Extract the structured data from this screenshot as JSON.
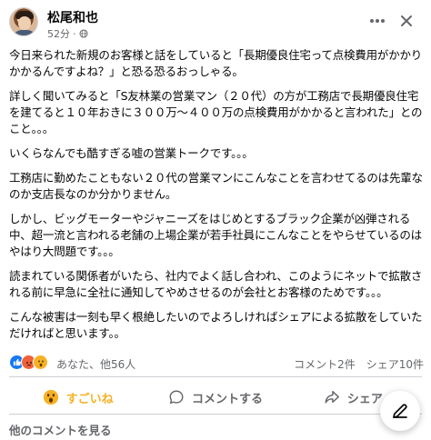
{
  "post": {
    "author": "松尾和也",
    "time": "52分",
    "paragraphs": [
      "今日来られた新規のお客様と話をしていると「長期優良住宅って点検費用がかかりかかるんですよね？」と恐る恐るおっしゃる。",
      "詳しく聞いてみると「S友林業の営業マン（２０代）の方が工務店で長期優良住宅を建てると１０年おきに３００万～４００万の点検費用がかかると言われた」とのこと。。。",
      "いくらなんでも酷すぎる嘘の営業トークです。。。",
      "工務店に勤めたこともない２０代の営業マンにこんなことを言わせてるのは先輩なのか支店長なのか分かりません。",
      "しかし、ビッグモーターやジャニーズをはじめとするブラック企業が凶弾される中、超一流と言われる老舗の上場企業が若手社員にこんなことをやらせているのはやはり大問題です。。。",
      "読まれている関係者がいたら、社内でよく話し合われ、このようにネットで拡散される前に早急に全社に通知してやめさせるのが会社とお客様のためです。。。",
      "こんな被害は一刻も早く根絶したいのでよろしければシェアによる拡散をしていただければと思います。。"
    ]
  },
  "reactions": {
    "summary": "あなた、他56人",
    "comments": "コメント2件",
    "shares": "シェア10件"
  },
  "actions": {
    "react_label": "すごいね",
    "comment_label": "コメントする",
    "share_label": "シェア"
  },
  "footer": {
    "see_more": "他のコメントを見る"
  },
  "colors": {
    "accent": "#1877f2",
    "wow": "#f7b125",
    "secondary_text": "#65676b"
  }
}
